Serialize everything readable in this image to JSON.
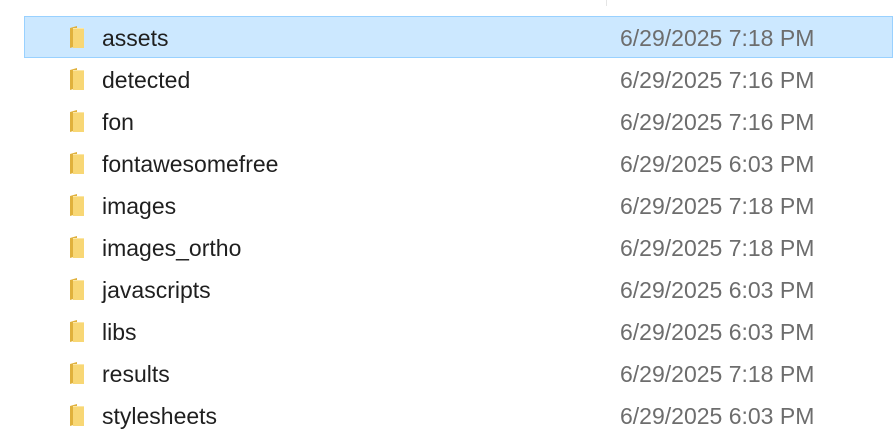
{
  "file_list": {
    "items": [
      {
        "name": "assets",
        "modified": "6/29/2025 7:18 PM",
        "selected": true,
        "icon": "folder-icon"
      },
      {
        "name": "detected",
        "modified": "6/29/2025 7:16 PM",
        "selected": false,
        "icon": "folder-icon"
      },
      {
        "name": "fon",
        "modified": "6/29/2025 7:16 PM",
        "selected": false,
        "icon": "folder-icon"
      },
      {
        "name": "fontawesomefree",
        "modified": "6/29/2025 6:03 PM",
        "selected": false,
        "icon": "folder-icon"
      },
      {
        "name": "images",
        "modified": "6/29/2025 7:18 PM",
        "selected": false,
        "icon": "folder-icon"
      },
      {
        "name": "images_ortho",
        "modified": "6/29/2025 7:18 PM",
        "selected": false,
        "icon": "folder-icon"
      },
      {
        "name": "javascripts",
        "modified": "6/29/2025 6:03 PM",
        "selected": false,
        "icon": "folder-icon"
      },
      {
        "name": "libs",
        "modified": "6/29/2025 6:03 PM",
        "selected": false,
        "icon": "folder-icon"
      },
      {
        "name": "results",
        "modified": "6/29/2025 7:18 PM",
        "selected": false,
        "icon": "folder-icon"
      },
      {
        "name": "stylesheets",
        "modified": "6/29/2025 6:03 PM",
        "selected": false,
        "icon": "folder-icon"
      }
    ]
  },
  "colors": {
    "selection_bg": "#cce8ff",
    "selection_border": "#99d1ff",
    "folder_yellow": "#f8d775",
    "folder_dark": "#e0b13c",
    "name_text": "#1f1f1f",
    "date_text": "#6d6d6d"
  }
}
